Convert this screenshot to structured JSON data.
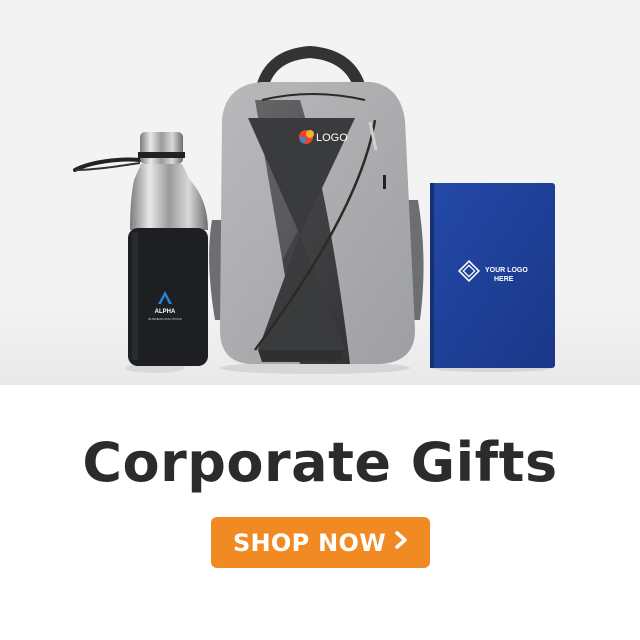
{
  "hero": {
    "bottle_brand_line1": "ALPHA",
    "bottle_brand_line2": "BUSINESS SOLUTIONS",
    "backpack_logo": "LOGO",
    "notebook_logo_line1": "YOUR LOGO",
    "notebook_logo_line2": "HERE"
  },
  "headline": "Corporate Gifts",
  "cta": {
    "label": "SHOP NOW",
    "icon": "chevron-right-icon"
  },
  "colors": {
    "accent": "#f28a24",
    "headline": "#2b2b2b",
    "notebook": "#1f3f9e",
    "hero_bg": "#f3f3f4"
  }
}
